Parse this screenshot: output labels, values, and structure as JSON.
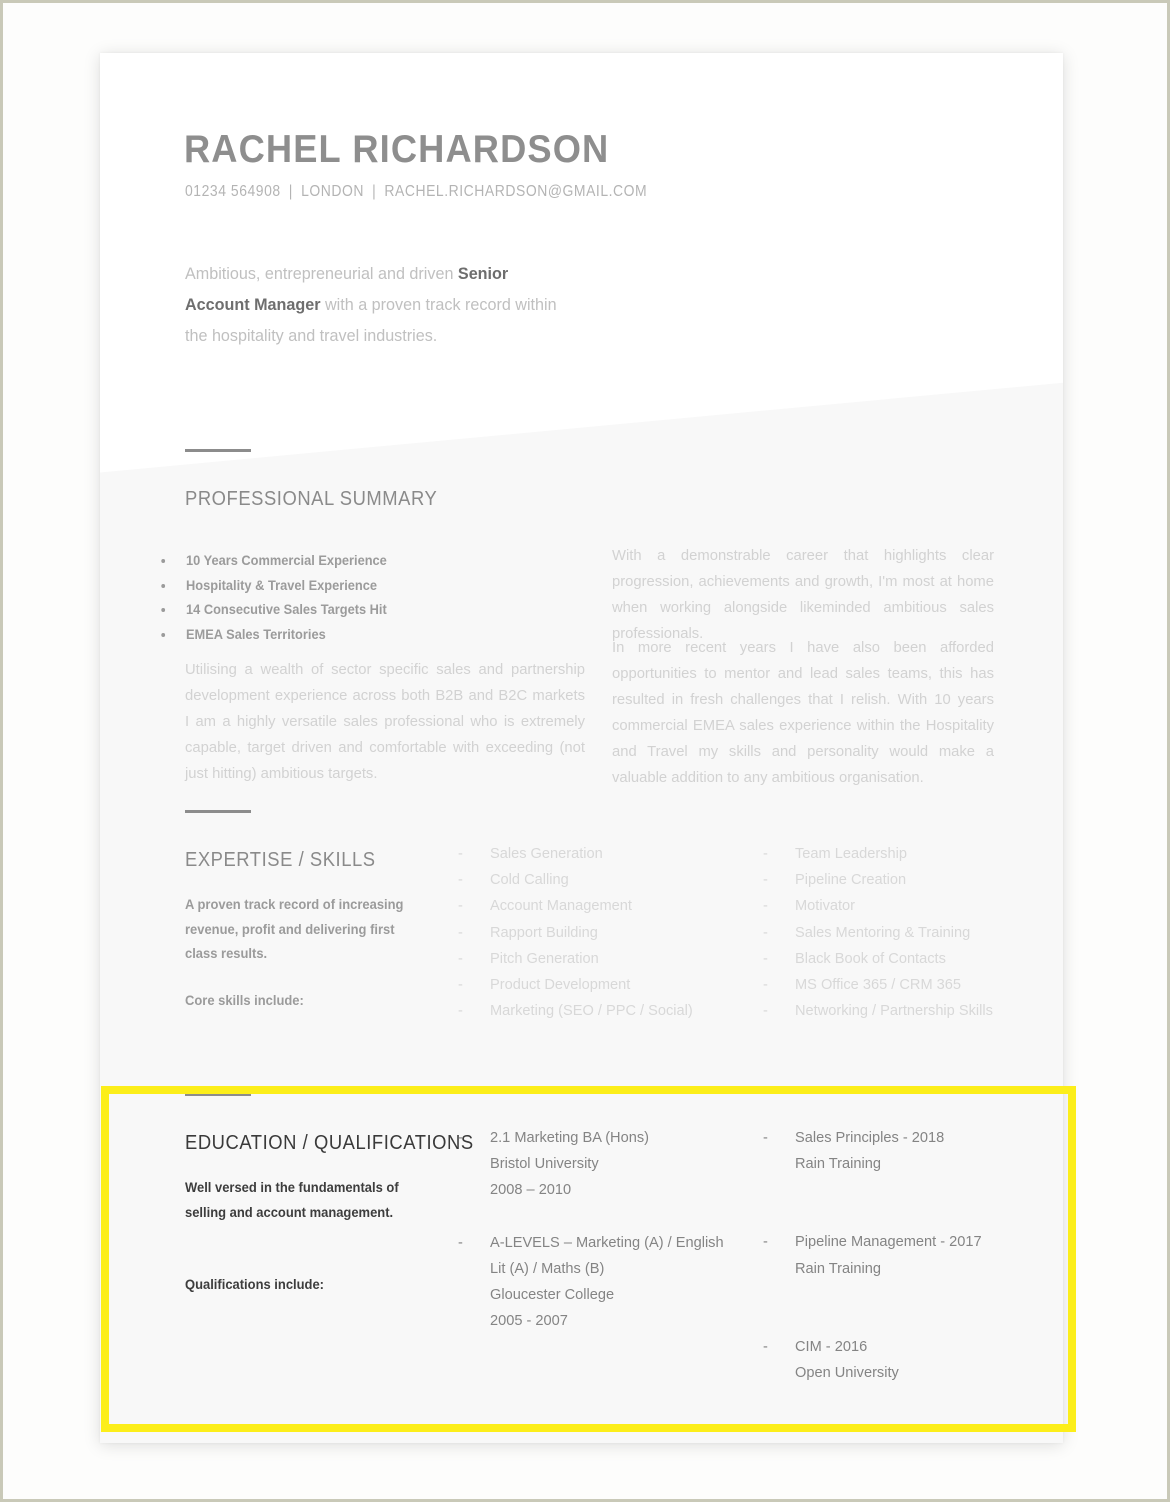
{
  "document": {
    "type": "resume",
    "highlight_color": "#fcee1a",
    "accent_color": "#8c8c8c"
  },
  "header": {
    "name": "RACHEL RICHARDSON",
    "phone": "01234 564908",
    "location": "LONDON",
    "email": "RACHEL.RICHARDSON@GMAIL.COM",
    "separator": "|",
    "intro_before": "Ambitious, entrepreneurial and driven ",
    "intro_bold": "Senior Account Manager",
    "intro_after": " with a proven track record within the hospitality and travel industries."
  },
  "professional_summary": {
    "title": "PROFESSIONAL SUMMARY",
    "bullets": [
      "10 Years Commercial Experience",
      "Hospitality & Travel Experience",
      "14 Consecutive Sales Targets Hit",
      "EMEA Sales Territories"
    ],
    "left_paragraph": "Utilising a wealth of sector specific sales and partnership development experience across both B2B and B2C markets I am a highly versatile sales professional who is extremely capable, target driven and comfortable with exceeding (not just hitting) ambitious targets.",
    "right_paragraph_1": "With a demonstrable career that highlights clear progression, achievements and growth, I'm most at home when working alongside likeminded ambitious sales professionals.",
    "right_paragraph_2": "In more recent years I have also been afforded opportunities to mentor and lead sales teams, this has resulted in fresh challenges that I relish.   With 10 years commercial EMEA sales experience within the Hospitality and Travel my skills and personality would make a valuable addition to any ambitious organisation."
  },
  "expertise": {
    "title": "EXPERTISE / SKILLS",
    "note": "A proven track record of increasing revenue, profit and delivering first class results.",
    "note_subheading": "Core skills include:",
    "dash": "-",
    "column_1": [
      "Sales Generation",
      "Cold Calling",
      "Account Management",
      "Rapport Building",
      "Pitch Generation",
      "Product Development",
      "Marketing (SEO / PPC / Social)"
    ],
    "column_2": [
      "Team Leadership",
      "Pipeline Creation",
      "Motivator",
      "Sales Mentoring & Training",
      "Black Book of Contacts",
      "MS Office 365 / CRM 365",
      "Networking / Partnership Skills"
    ]
  },
  "education": {
    "title": "EDUCATION / QUALIFICATIONS",
    "note": "Well versed in the fundamentals of selling and account management.",
    "note_subheading": "Qualifications include:",
    "dash": "-",
    "column_1": [
      {
        "line1": "2.1 Marketing BA (Hons)",
        "line2": "Bristol University",
        "line3": "2008 – 2010",
        "line4": ""
      },
      {
        "line1": "A-LEVELS – Marketing (A) / English",
        "line2": "Lit (A) / Maths (B)",
        "line3": "Gloucester College",
        "line4": "2005 - 2007"
      }
    ],
    "column_2": [
      {
        "line1": "Sales Principles - 2018",
        "line2": "Rain Training",
        "line3": "",
        "line4": ""
      },
      {
        "line1": "Pipeline Management - 2017",
        "line2": "Rain Training",
        "line3": "",
        "line4": ""
      },
      {
        "line1": "CIM - 2016",
        "line2": "Open University",
        "line3": "",
        "line4": ""
      }
    ]
  }
}
